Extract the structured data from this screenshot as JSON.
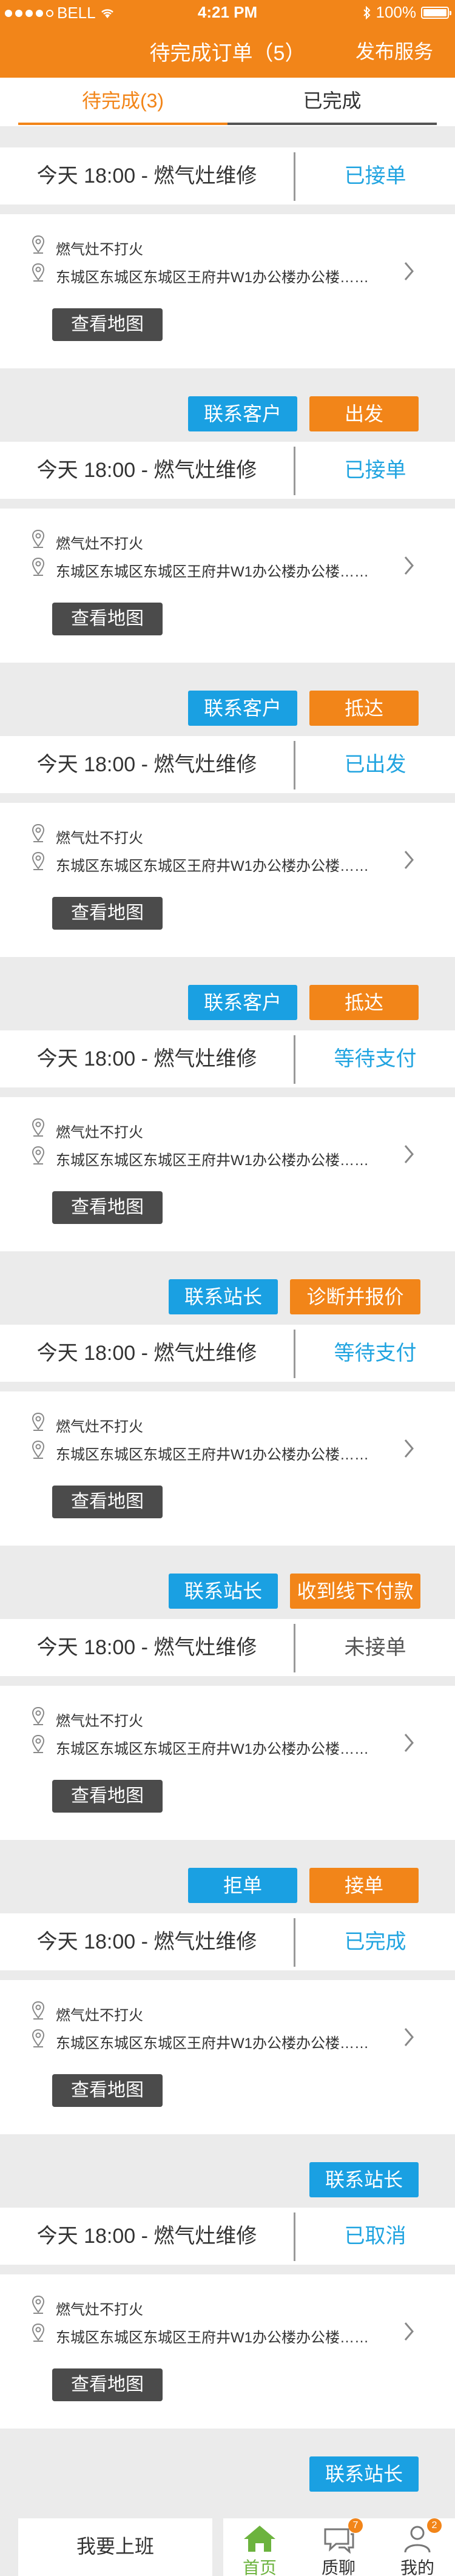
{
  "status_bar": {
    "carrier": "BELL",
    "time": "4:21 PM",
    "battery": "100%"
  },
  "nav": {
    "title": "待完成订单（5）",
    "right_action": "发布服务"
  },
  "tabs": [
    {
      "label": "待完成(3)",
      "active": true
    },
    {
      "label": "已完成",
      "active": false
    }
  ],
  "orders": [
    {
      "title": "今天  18:00  -  燃气灶维修",
      "status": "已接单",
      "status_color": "#21a4e0",
      "fault": "燃气灶不打火",
      "address": "东城区东城区东城区王府井W1办公楼办公楼……",
      "map_label": "查看地图",
      "actions": [
        "联系客户",
        "出发"
      ]
    },
    {
      "title": "今天  18:00  -  燃气灶维修",
      "status": "已接单",
      "status_color": "#21a4e0",
      "fault": "燃气灶不打火",
      "address": "东城区东城区东城区王府井W1办公楼办公楼……",
      "map_label": "查看地图",
      "actions": [
        "联系客户",
        "抵达"
      ]
    },
    {
      "title": "今天  18:00  -  燃气灶维修",
      "status": "已出发",
      "status_color": "#21a4e0",
      "fault": "燃气灶不打火",
      "address": "东城区东城区东城区王府井W1办公楼办公楼……",
      "map_label": "查看地图",
      "actions": [
        "联系客户",
        "抵达"
      ]
    },
    {
      "title": "今天  18:00  -  燃气灶维修",
      "status": "等待支付",
      "status_color": "#21a4e0",
      "fault": "燃气灶不打火",
      "address": "东城区东城区东城区王府井W1办公楼办公楼……",
      "map_label": "查看地图",
      "actions": [
        "联系站长",
        "诊断并报价"
      ]
    },
    {
      "title": "今天  18:00  -  燃气灶维修",
      "status": "等待支付",
      "status_color": "#21a4e0",
      "fault": "燃气灶不打火",
      "address": "东城区东城区东城区王府井W1办公楼办公楼……",
      "map_label": "查看地图",
      "actions": [
        "联系站长",
        "收到线下付款"
      ]
    },
    {
      "title": "今天  18:00  -  燃气灶维修",
      "status": "未接单",
      "status_color": "#555555",
      "fault": "燃气灶不打火",
      "address": "东城区东城区东城区王府井W1办公楼办公楼……",
      "map_label": "查看地图",
      "actions": [
        "拒单",
        "接单"
      ]
    },
    {
      "title": "今天  18:00  -  燃气灶维修",
      "status": "已完成",
      "status_color": "#21a4e0",
      "fault": "燃气灶不打火",
      "address": "东城区东城区东城区王府井W1办公楼办公楼……",
      "map_label": "查看地图",
      "actions": [
        "联系站长"
      ]
    },
    {
      "title": "今天  18:00  -  燃气灶维修",
      "status": "已取消",
      "status_color": "#21a4e0",
      "fault": "燃气灶不打火",
      "address": "东城区东城区东城区王府井W1办公楼办公楼……",
      "map_label": "查看地图",
      "actions": [
        "联系站长"
      ]
    }
  ],
  "bottom_bar": {
    "go_to_work": "我要上班",
    "items": [
      {
        "label": "首页",
        "icon": "home-icon",
        "active": true,
        "badge": ""
      },
      {
        "label": "质聊",
        "icon": "chat-icon",
        "active": false,
        "badge": "7"
      },
      {
        "label": "我的",
        "icon": "user-icon",
        "active": false,
        "badge": "2"
      }
    ]
  },
  "colors": {
    "accent": "#f28519",
    "link_blue": "#21a4e0",
    "button_blue": "#1aa0e2",
    "active_green": "#6cb33e"
  }
}
